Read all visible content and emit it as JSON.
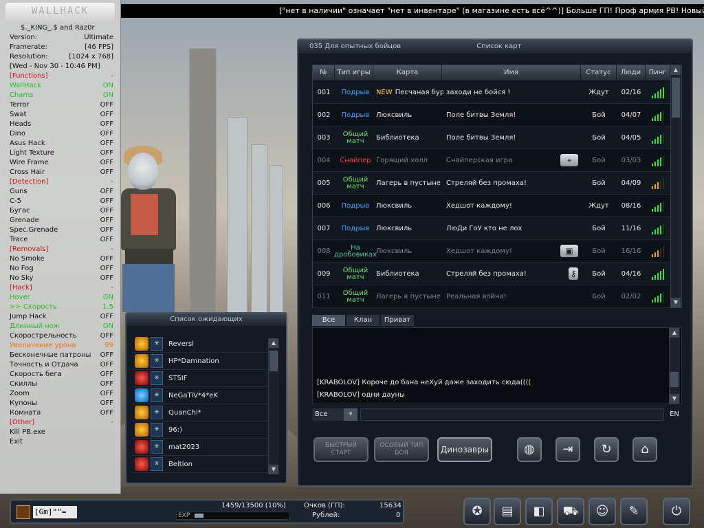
{
  "ticker": "[\"нет в наличии\" означает \"нет в инвентаре\" (в магазине есть всё^^)] Больше ГП! Проф армия PB! Новый магазин! И т",
  "hack": {
    "logo": "WALLHACK",
    "author": "$._KING_.$ and Raz0r",
    "info": [
      {
        "k": "Version:",
        "v": "Ultimate"
      },
      {
        "k": "Framerate:",
        "v": "[46 FPS]"
      },
      {
        "k": "Resolution:",
        "v": "[1024 x 768]"
      }
    ],
    "date": "[Wed - Nov 30 - 10:46 PM]",
    "functions_header": "[Functions]",
    "functions": [
      {
        "k": "WallHack",
        "v": "ON"
      },
      {
        "k": "Chams",
        "v": "ON"
      },
      {
        "k": "Terror",
        "v": "OFF"
      },
      {
        "k": "Swat",
        "v": "OFF"
      },
      {
        "k": "Heads",
        "v": "OFF"
      },
      {
        "k": "Dino",
        "v": "OFF"
      },
      {
        "k": "Asus Hack",
        "v": "OFF"
      },
      {
        "k": "Light Texture",
        "v": "OFF"
      },
      {
        "k": "Wire Frame",
        "v": "OFF"
      },
      {
        "k": "Cross Hair",
        "v": "OFF"
      }
    ],
    "detection_header": "[Detection]",
    "detection": [
      {
        "k": "Guns",
        "v": "OFF"
      },
      {
        "k": "C-5",
        "v": "OFF"
      },
      {
        "k": "Бугас",
        "v": "OFF"
      },
      {
        "k": "Grenade",
        "v": "OFF"
      },
      {
        "k": "Spec.Grenade",
        "v": "OFF"
      },
      {
        "k": "Trace",
        "v": "OFF"
      }
    ],
    "removals_header": "[Removals]",
    "removals": [
      {
        "k": "No Smoke",
        "v": "OFF"
      },
      {
        "k": "No Fog",
        "v": "OFF"
      },
      {
        "k": "No Sky",
        "v": "OFF"
      }
    ],
    "hack_header": "[Hack]",
    "hack_items": [
      {
        "k": "Hover",
        "v": "ON",
        "style": "on"
      },
      {
        "k": ">> Скорость",
        "v": "1.5",
        "style": "on"
      },
      {
        "k": "Jump Hack",
        "v": "OFF",
        "style": ""
      },
      {
        "k": "Длинный нож",
        "v": "ON",
        "style": "on"
      },
      {
        "k": "Скорострельность",
        "v": "OFF",
        "style": ""
      },
      {
        "k": "Увеличение урона",
        "v": "99",
        "style": "orange"
      },
      {
        "k": "Бесконечные патроны",
        "v": "OFF",
        "style": ""
      },
      {
        "k": "Точность и Отдача",
        "v": "OFF",
        "style": ""
      },
      {
        "k": "Скорость бега",
        "v": "OFF",
        "style": ""
      },
      {
        "k": "Скиллы",
        "v": "OFF",
        "style": ""
      },
      {
        "k": "Zoom",
        "v": "OFF",
        "style": ""
      },
      {
        "k": "Купоны",
        "v": "OFF",
        "style": ""
      },
      {
        "k": "Комната",
        "v": "OFF",
        "style": ""
      }
    ],
    "other_header": "[Other]",
    "other": [
      "Kill PB.exe",
      "Exit"
    ],
    "header_marker": "-"
  },
  "room_panel": {
    "server": "035 Для опытных бойцов",
    "title": "Список карт",
    "columns": [
      "№",
      "Тип игры",
      "Карта",
      "Имя",
      "Статус",
      "Люди",
      "Пинг"
    ],
    "new_label": "NEW",
    "rows": [
      {
        "num": "001",
        "mode": "Подрыв",
        "mode_color": "blue",
        "map": "Песчаная буря",
        "name": "заходи  не бойся !",
        "status": "Ждут",
        "people": "02/16",
        "ping": 5,
        "dim": false,
        "isnew": true,
        "icon": ""
      },
      {
        "num": "002",
        "mode": "Подрыв",
        "mode_color": "blue",
        "map": "Люксвиль",
        "name": "Поле битвы Земля!",
        "status": "Бой",
        "people": "04/07",
        "ping": 4,
        "dim": false,
        "isnew": false,
        "icon": ""
      },
      {
        "num": "003",
        "mode": "Общий матч",
        "mode_color": "green",
        "map": "Библиотека",
        "name": "Поле битвы Земля!",
        "status": "Бой",
        "people": "04/05",
        "ping": 4,
        "dim": false,
        "isnew": false,
        "icon": ""
      },
      {
        "num": "004",
        "mode": "Снайпер",
        "mode_color": "red",
        "map": "Горящий холл",
        "name": "Снайперская игра",
        "status": "Бой",
        "people": "03/03",
        "ping": 4,
        "dim": true,
        "isnew": false,
        "icon": "⌖"
      },
      {
        "num": "005",
        "mode": "Общий матч",
        "mode_color": "green",
        "map": "Лагерь в пустыне",
        "name": "Стреляй без промаха!",
        "status": "Бой",
        "people": "04/09",
        "ping": 3,
        "dim": false,
        "isnew": false,
        "icon": "",
        "low": true
      },
      {
        "num": "006",
        "mode": "Подрыв",
        "mode_color": "blue",
        "map": "Люксвиль",
        "name": "Хедшот каждому!",
        "status": "Ждут",
        "people": "08/16",
        "ping": 4,
        "dim": false,
        "isnew": false,
        "icon": ""
      },
      {
        "num": "007",
        "mode": "Подрыв",
        "mode_color": "blue",
        "map": "Люксвиль",
        "name": "ЛюДи ГоУ кто не лох",
        "status": "Бой",
        "people": "11/16",
        "ping": 4,
        "dim": false,
        "isnew": false,
        "icon": ""
      },
      {
        "num": "008",
        "mode": "На дробовиках",
        "mode_color": "teal",
        "map": "Люксвиль",
        "name": "Хедшот каждому!",
        "status": "Бой",
        "people": "16/16",
        "ping": 3,
        "dim": true,
        "isnew": false,
        "icon": "▣",
        "low": true
      },
      {
        "num": "009",
        "mode": "Общий матч",
        "mode_color": "green",
        "map": "Библиотека",
        "name": "Стреляй без промаха!",
        "status": "Бой",
        "people": "04/16",
        "ping": 5,
        "dim": false,
        "isnew": false,
        "icon": "⚷"
      },
      {
        "num": "011",
        "mode": "Общий матч",
        "mode_color": "green",
        "map": "Лагерь в пустыне",
        "name": "Реальная война!",
        "status": "Бой",
        "people": "02/02",
        "ping": 4,
        "dim": true,
        "isnew": false,
        "icon": ""
      }
    ]
  },
  "chat": {
    "tabs": [
      "Все",
      "Клан",
      "Приват"
    ],
    "messages": [
      "[KRABOLOV] Короче до бана неХуй даже заходить сюда((((",
      "[KRABOLOV] одни дауны"
    ],
    "channel": "Все",
    "lang": "EN"
  },
  "buttons": {
    "quick": "БЫСТРЫЙ СТАРТ",
    "special": "ОСОБЫЙ ТИП БОЯ",
    "dino": "Динозавры"
  },
  "waiting": {
    "title": "Список ожидающих",
    "players": [
      {
        "name": "Reversl",
        "rank": "gold"
      },
      {
        "name": "HP*Damnation",
        "rank": "gold"
      },
      {
        "name": "ST5IF",
        "rank": "red"
      },
      {
        "name": "NeGaTiV*4*eK",
        "rank": "blue"
      },
      {
        "name": "QuanChi*",
        "rank": "gold"
      },
      {
        "name": "96:)",
        "rank": "gold"
      },
      {
        "name": "mat2023",
        "rank": "red"
      },
      {
        "name": "Beltion",
        "rank": "red"
      }
    ]
  },
  "status": {
    "nick": "[Gm]\"\"=",
    "exp_text": "1459/13500 (10%)",
    "exp_label": "EXP",
    "exp_fraction": 0.108,
    "points_label": "Очков (ГП):",
    "points": "15634",
    "rubles_label": "Рублей:",
    "rubles": "0"
  }
}
